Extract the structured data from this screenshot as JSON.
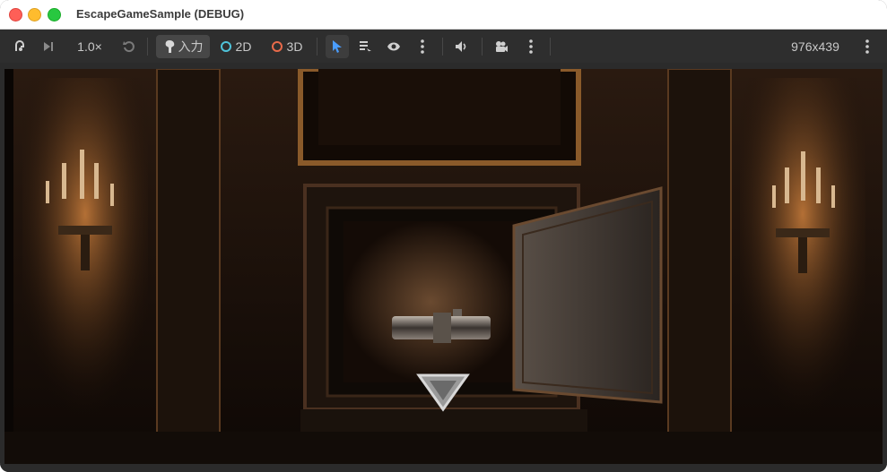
{
  "window": {
    "title": "EscapeGameSample (DEBUG)"
  },
  "toolbar": {
    "speed": "1.0×",
    "input_label": "入力",
    "mode_2d": "2D",
    "mode_3d": "3D",
    "resolution": "976x439",
    "colors": {
      "mode_2d": "#4fc3d9",
      "mode_3d": "#e86a4a",
      "select_active": "#4a9dff"
    }
  },
  "icons": [
    "debug-icon",
    "step-icon",
    "reset-icon",
    "input-icon",
    "select-arrow-icon",
    "list-icon",
    "eye-icon",
    "more-icon",
    "volume-icon",
    "camera-icon",
    "more-icon"
  ]
}
